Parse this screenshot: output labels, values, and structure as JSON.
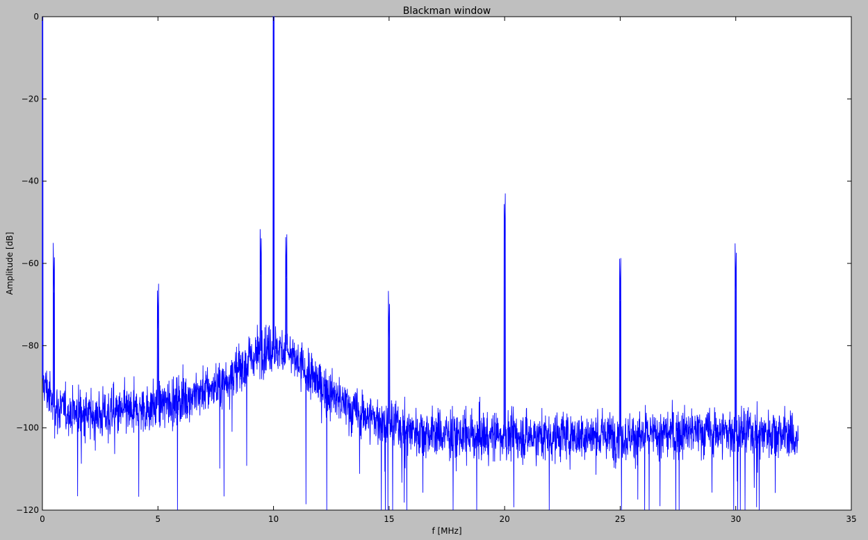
{
  "chart_data": {
    "type": "line",
    "title": "Blackman window",
    "xlabel": "f [MHz]",
    "ylabel": "Amplitude [dB]",
    "xlim": [
      0,
      35
    ],
    "ylim": [
      -120,
      0
    ],
    "xticks": [
      0,
      5,
      10,
      15,
      20,
      25,
      30,
      35
    ],
    "yticks": [
      0,
      -20,
      -40,
      -60,
      -80,
      -100,
      -120
    ],
    "grid": false,
    "legend": "none",
    "series": [
      {
        "color": "#0000ff",
        "noise_floor": [
          [
            0.0,
            -88
          ],
          [
            0.5,
            -95
          ],
          [
            2.0,
            -97
          ],
          [
            4.0,
            -96
          ],
          [
            6.0,
            -93
          ],
          [
            7.5,
            -90
          ],
          [
            8.5,
            -86
          ],
          [
            9.5,
            -81
          ],
          [
            10.5,
            -81
          ],
          [
            11.5,
            -87
          ],
          [
            12.5,
            -92
          ],
          [
            13.5,
            -96
          ],
          [
            15.0,
            -99
          ],
          [
            16.5,
            -101
          ],
          [
            18.0,
            -102
          ],
          [
            20.0,
            -102
          ],
          [
            22.0,
            -102
          ],
          [
            24.0,
            -102
          ],
          [
            26.0,
            -102
          ],
          [
            28.0,
            -101
          ],
          [
            30.0,
            -101
          ],
          [
            32.0,
            -101
          ],
          [
            32.7,
            -103
          ]
        ],
        "peaks": [
          {
            "f": 0.0,
            "db": 0
          },
          {
            "f": 0.5,
            "db": -67
          },
          {
            "f": 5.0,
            "db": -76
          },
          {
            "f": 9.45,
            "db": -63
          },
          {
            "f": 10.0,
            "db": -2
          },
          {
            "f": 10.55,
            "db": -63.5
          },
          {
            "f": 15.0,
            "db": -78.5
          },
          {
            "f": 20.0,
            "db": -54.5
          },
          {
            "f": 25.0,
            "db": -69
          },
          {
            "f": 30.0,
            "db": -66.5
          }
        ],
        "f_max": 32.7
      }
    ]
  }
}
